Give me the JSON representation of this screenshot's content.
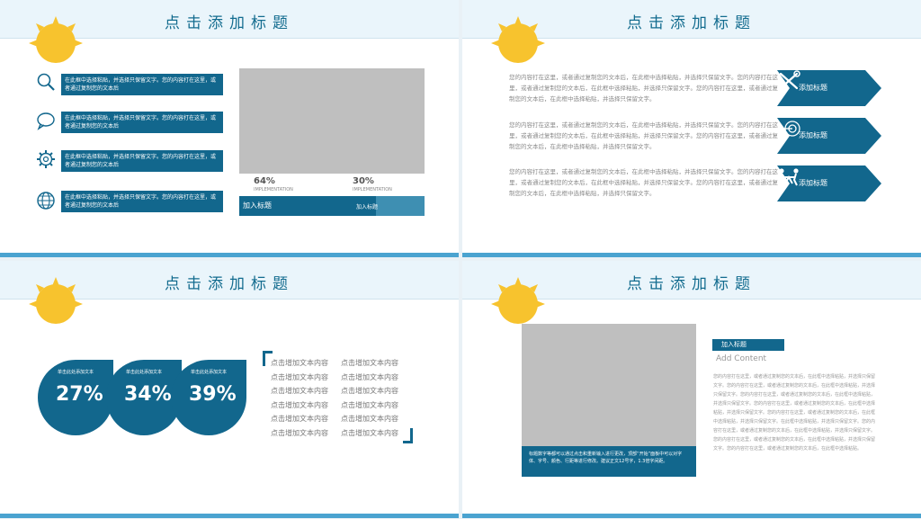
{
  "colors": {
    "accent": "#12678d",
    "light_accent": "#3e8fb2",
    "header_bg": "#eaf5fb",
    "sun": "#f7c32e",
    "bottom_bar": "#4aa3d0"
  },
  "slide1": {
    "title": "点击添加标题",
    "features": [
      {
        "icon": "search-icon",
        "text": "在此框中选择粘贴，并选择只保留文字。您的内容打在这里，或者通过复制您的文本后"
      },
      {
        "icon": "chat-icon",
        "text": "在此框中选择粘贴，并选择只保留文字。您的内容打在这里，或者通过复制您的文本后"
      },
      {
        "icon": "gear-icon",
        "text": "在此框中选择粘贴，并选择只保留文字。您的内容打在这里，或者通过复制您的文本后"
      },
      {
        "icon": "globe-icon",
        "text": "在此框中选择粘贴，并选择只保留文字。您的内容打在这里，或者通过复制您的文本后"
      }
    ],
    "stat1": {
      "value": "64%",
      "label": "IMPLEMENTATION"
    },
    "stat2": {
      "value": "30%",
      "label": "IMPLEMENTATION"
    },
    "bar_left": "加入标题",
    "bar_right": "加入标题"
  },
  "slide2": {
    "title": "点击添加标题",
    "paragraphs": [
      "您的内容打在这里，或者通过复制您的文本后，在此框中选择粘贴，并选择只保留文字。您的内容打在这里，或者通过复制您的文本后，在此框中选择粘贴，并选择只保留文字。您的内容打在这里，或者通过复制您的文本后，在此框中选择粘贴，并选择只保留文字。",
      "您的内容打在这里，或者通过复制您的文本后，在此框中选择粘贴，并选择只保留文字。您的内容打在这里，或者通过复制您的文本后，在此框中选择粘贴，并选择只保留文字。您的内容打在这里，或者通过复制您的文本后，在此框中选择粘贴，并选择只保留文字。",
      "您的内容打在这里，或者通过复制您的文本后，在此框中选择粘贴，并选择只保留文字。您的内容打在这里，或者通过复制您的文本后，在此框中选择粘贴，并选择只保留文字。您的内容打在这里，或者通过复制您的文本后，在此框中选择粘贴，并选择只保留文字。"
    ],
    "arrows": [
      {
        "label": "添加标题",
        "icon": "tools-icon"
      },
      {
        "label": "添加标题",
        "icon": "target-icon"
      },
      {
        "label": "添加标题",
        "icon": "teamwork-icon"
      }
    ]
  },
  "slide3": {
    "title": "点击添加标题",
    "drops": [
      {
        "label": "单击此处添加文本",
        "value": "27%"
      },
      {
        "label": "单击此处添加文本",
        "value": "34%"
      },
      {
        "label": "单击此处添加文本",
        "value": "39%"
      }
    ],
    "list_left": [
      "点击增加文本内容",
      "点击增加文本内容",
      "点击增加文本内容",
      "点击增加文本内容",
      "点击增加文本内容",
      "点击增加文本内容"
    ],
    "list_right": [
      "点击增加文本内容",
      "点击增加文本内容",
      "点击增加文本内容",
      "点击增加文本内容",
      "点击增加文本内容",
      "点击增加文本内容"
    ]
  },
  "slide4": {
    "title": "点击添加标题",
    "caption": "标题数字等都可以通过点击和重新输入进行更改，顶部“开始”面板中可以对字体、字号、颜色、行距等进行修改。建议正文12号字，1.3倍字间距。",
    "tag": "加入标题",
    "subtitle": "Add Content",
    "body": "您的内容打在这里，或者通过复制您的文本后，在此框中选择粘贴，并选择只保留文字。您的内容打在这里，或者通过复制您的文本后，在此框中选择粘贴，并选择只保留文字。您的内容打在这里，或者通过复制您的文本后，在此框中选择粘贴，并选择只保留文字。您的内容打在这里，或者通过复制您的文本后，在此框中选择粘贴，并选择只保留文字。您的内容打在这里，或者通过复制您的文本后，在此框中选择粘贴，并选择只保留文字。在此框中选择粘贴，并选择只保留文字。您的内容打在这里，或者通过复制您的文本后，在此框中选择粘贴，并选择只保留文字。您的内容打在这里，或者通过复制您的文本后，在此框中选择粘贴，并选择只保留文字。您的内容打在这里，或者通过复制您的文本后，在此框中选择粘贴。"
  }
}
